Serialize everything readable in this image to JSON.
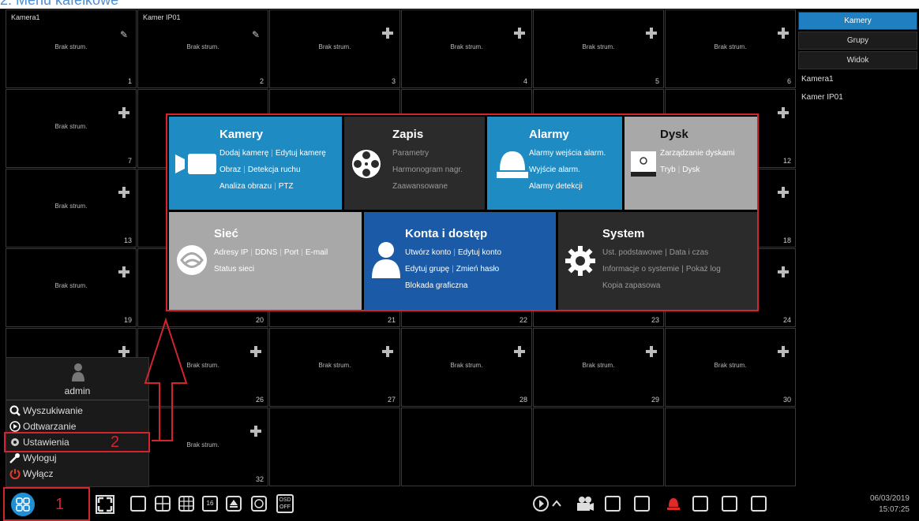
{
  "heading": "2. Menu kafelkowe",
  "cells": [
    {
      "name": "Kamera1",
      "status": "Brak strum.",
      "num": "1",
      "icon": "pencil"
    },
    {
      "name": "Kamer IP01",
      "status": "Brak strum.",
      "num": "2",
      "icon": "pencil"
    },
    {
      "name": "",
      "status": "Brak strum.",
      "num": "3",
      "icon": "plus"
    },
    {
      "name": "",
      "status": "Brak strum.",
      "num": "4",
      "icon": "plus"
    },
    {
      "name": "",
      "status": "Brak strum.",
      "num": "5",
      "icon": "plus"
    },
    {
      "name": "",
      "status": "Brak strum.",
      "num": "6",
      "icon": "plus"
    },
    {
      "name": "",
      "status": "Brak strum.",
      "num": "7",
      "icon": "plus"
    },
    {
      "name": "",
      "status": "",
      "num": "",
      "icon": "none"
    },
    {
      "name": "",
      "status": "",
      "num": "",
      "icon": "none"
    },
    {
      "name": "",
      "status": "",
      "num": "",
      "icon": "none"
    },
    {
      "name": "",
      "status": "",
      "num": "",
      "icon": "none"
    },
    {
      "name": "",
      "status": "",
      "num": "12",
      "icon": "plus"
    },
    {
      "name": "",
      "status": "Brak strum.",
      "num": "13",
      "icon": "plus"
    },
    {
      "name": "",
      "status": "",
      "num": "",
      "icon": "none"
    },
    {
      "name": "",
      "status": "",
      "num": "",
      "icon": "none"
    },
    {
      "name": "",
      "status": "",
      "num": "",
      "icon": "none"
    },
    {
      "name": "",
      "status": "",
      "num": "",
      "icon": "none"
    },
    {
      "name": "",
      "status": "",
      "num": "18",
      "icon": "plus"
    },
    {
      "name": "",
      "status": "Brak strum.",
      "num": "19",
      "icon": "plus"
    },
    {
      "name": "",
      "status": "",
      "num": "20",
      "icon": "none"
    },
    {
      "name": "",
      "status": "",
      "num": "21",
      "icon": "none"
    },
    {
      "name": "",
      "status": "",
      "num": "22",
      "icon": "none"
    },
    {
      "name": "",
      "status": "",
      "num": "23",
      "icon": "none"
    },
    {
      "name": "",
      "status": "",
      "num": "24",
      "icon": "plus"
    },
    {
      "name": "",
      "status": "",
      "num": "",
      "icon": "plus"
    },
    {
      "name": "",
      "status": "Brak strum.",
      "num": "26",
      "icon": "plus"
    },
    {
      "name": "",
      "status": "Brak strum.",
      "num": "27",
      "icon": "plus"
    },
    {
      "name": "",
      "status": "Brak strum.",
      "num": "28",
      "icon": "plus"
    },
    {
      "name": "",
      "status": "Brak strum.",
      "num": "29",
      "icon": "plus"
    },
    {
      "name": "",
      "status": "Brak strum.",
      "num": "30",
      "icon": "plus"
    },
    {
      "name": "",
      "status": "",
      "num": "",
      "icon": "none"
    },
    {
      "name": "",
      "status": "Brak strum.",
      "num": "32",
      "icon": "plus"
    },
    {
      "name": "",
      "status": "",
      "num": "",
      "icon": "none"
    },
    {
      "name": "",
      "status": "",
      "num": "",
      "icon": "none"
    },
    {
      "name": "",
      "status": "",
      "num": "",
      "icon": "none"
    },
    {
      "name": "",
      "status": "",
      "num": "",
      "icon": "none"
    }
  ],
  "rightpanel": {
    "tabs": [
      "Kamery",
      "Grupy",
      "Widok"
    ],
    "cameras": [
      "Kamera1",
      "Kamer IP01"
    ]
  },
  "startmenu": {
    "user": "admin",
    "items": [
      "Wyszukiwanie",
      "Odtwarzanie",
      "Ustawienia",
      "Wyloguj",
      "Wyłącz"
    ]
  },
  "tiles": {
    "kamery": {
      "title": "Kamery",
      "l1a": "Dodaj kamerę",
      "l1b": "Edytuj kamerę",
      "l2a": "Obraz",
      "l2b": "Detekcja ruchu",
      "l3a": "Analiza obrazu",
      "l3b": "PTZ"
    },
    "zapis": {
      "title": "Zapis",
      "l1": "Parametry",
      "l2": "Harmonogram nagr.",
      "l3": "Zaawansowane"
    },
    "alarmy": {
      "title": "Alarmy",
      "l1": "Alarmy wejścia alarm.",
      "l2": "Wyjście alarm.",
      "l3": "Alarmy detekcji"
    },
    "dysk": {
      "title": "Dysk",
      "l1": "Zarządzanie dyskami",
      "l2a": "Tryb",
      "l2b": "Dysk"
    },
    "siec": {
      "title": "Sieć",
      "l1a": "Adresy IP",
      "l1b": "DDNS",
      "l1c": "Port",
      "l1d": "E-mail",
      "l2": "Status sieci"
    },
    "konta": {
      "title": "Konta i dostęp",
      "l1a": "Utwórz konto",
      "l1b": "Edytuj konto",
      "l2a": "Edytuj grupę",
      "l2b": "Zmień hasło",
      "l3": "Blokada graficzna"
    },
    "system": {
      "title": "System",
      "l1a": "Ust. podstawowe",
      "l1b": "Data i czas",
      "l2a": "Informacje o systemie",
      "l2b": "Pokaż log",
      "l3": "Kopia zapasowa"
    }
  },
  "taskbar": {
    "osd_top": "OSD",
    "osd_bottom": "OFF",
    "grid16": "16",
    "date": "06/03/2019",
    "time": "15:07:25"
  },
  "annotations": {
    "label1": "1",
    "label2": "2"
  },
  "colors": {
    "accent": "#1f7fc0",
    "annotation": "#d4252c",
    "tile_blue": "#1e8bc3",
    "tile_dark": "#2b2b2b",
    "tile_gray": "#a8a8a8",
    "tile_navy": "#1a5aa6"
  }
}
